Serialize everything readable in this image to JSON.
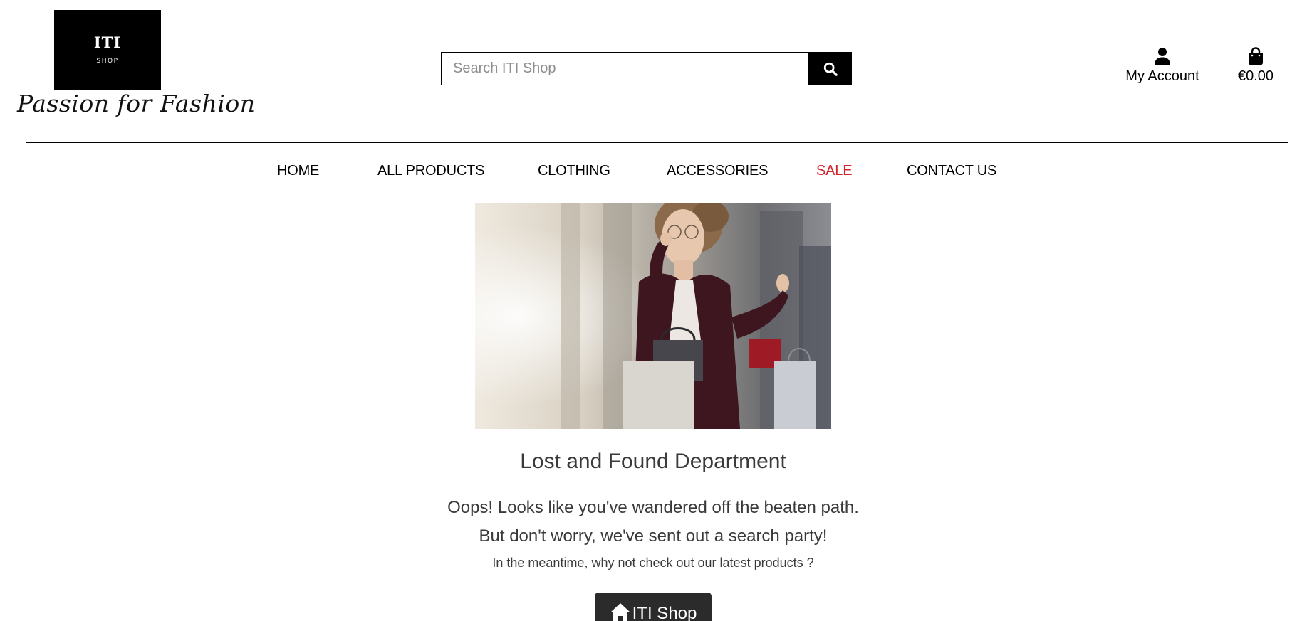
{
  "header": {
    "logo": {
      "title": "ITI",
      "subtitle": "SHOP"
    },
    "tagline": "Passion for Fashion",
    "search": {
      "placeholder": "Search ITI Shop",
      "value": "",
      "button_icon": "search-icon"
    },
    "account": {
      "icon": "user-icon",
      "label": "My Account"
    },
    "bag": {
      "icon": "shopping-bag-icon",
      "total": "€0.00"
    }
  },
  "nav": {
    "items": [
      {
        "label": "HOME"
      },
      {
        "label": "ALL PRODUCTS"
      },
      {
        "label": "CLOTHING"
      },
      {
        "label": "ACCESSORIES"
      },
      {
        "label": "SALE",
        "color": "#d4242a"
      },
      {
        "label": "CONTACT US"
      }
    ]
  },
  "main": {
    "title": "Lost and Found Department",
    "line1": "Oops! Looks like you've wandered off the beaten path.",
    "line2": "But don't worry, we've sent out a search party!",
    "line3": "In the meantime, why not check out our latest products ?",
    "button": {
      "icon": "home-icon",
      "label": "ITI Shop"
    }
  },
  "colors": {
    "accent_sale": "#d4242a",
    "button_bg": "#2b2b2b",
    "text_muted": "#3a3a3a"
  }
}
